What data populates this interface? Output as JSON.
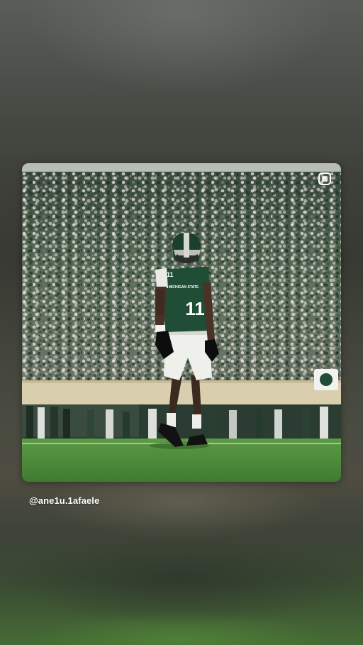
{
  "story": {
    "mention": "@ane1u.1afaele"
  },
  "post": {
    "jersey_number": "11",
    "chest_text": "MICHIGAN STATE",
    "icons": {
      "select_toggle": "square-select-icon"
    }
  },
  "colors": {
    "jersey_green": "#1f4d36",
    "field_green": "#4f8f3c",
    "caption_white": "#ffffff"
  }
}
